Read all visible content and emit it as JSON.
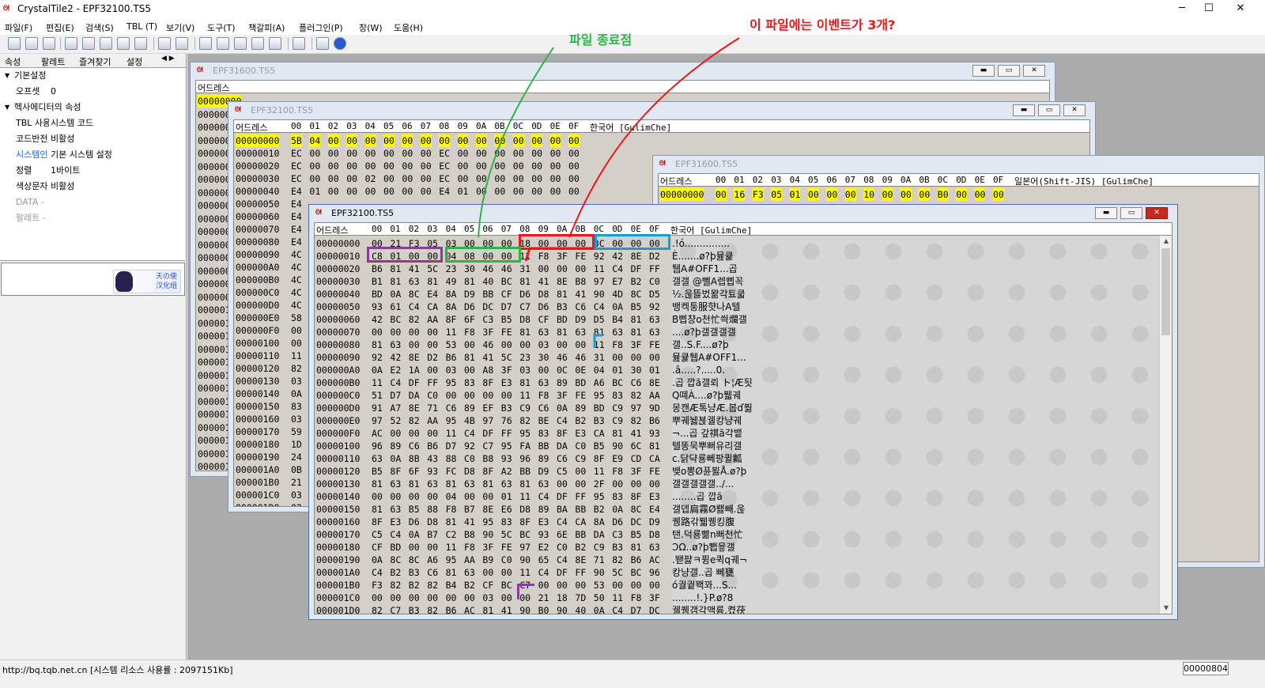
{
  "app": {
    "title": "CrystalTile2 - EPF32100.TS5",
    "min": "─",
    "max": "☐",
    "close": "✕"
  },
  "menu": [
    "파일(F)",
    "편집(E)",
    "검색(S)",
    "TBL (T)",
    "보기(V)",
    "도구(T)",
    "책갈피(A)",
    "플러그인(P)",
    "창(W)",
    "도움(H)"
  ],
  "panel": {
    "tabs": [
      "속성",
      "팔레트",
      "즐겨찾기",
      "설정"
    ],
    "tab_arrows": "◀ ▶",
    "rows": [
      {
        "key": "기본설정",
        "val": "",
        "type": "cat"
      },
      {
        "key": "오프셋",
        "val": "0",
        "type": "row"
      },
      {
        "key": "헥사에디터의 속성",
        "val": "",
        "type": "cat"
      },
      {
        "key": "TBL 사용",
        "val": "시스템 코드",
        "type": "row"
      },
      {
        "key": "코드반전",
        "val": "비활성",
        "type": "row"
      },
      {
        "key": "시스템인",
        "val": "기본 시스템 설정",
        "type": "blue"
      },
      {
        "key": "정렬",
        "val": "1바이트",
        "type": "row"
      },
      {
        "key": "색상문자",
        "val": "비활성",
        "type": "row"
      },
      {
        "key": "DATA -",
        "val": "",
        "type": "gray"
      },
      {
        "key": "팔레트 -",
        "val": "",
        "type": "gray"
      }
    ],
    "logo_text": "天の使\n汉化组"
  },
  "annotations": {
    "events_question": "이 파일에는 이벤트가 3개?",
    "file_end": "파일 종료점"
  },
  "hex_header": {
    "addr_label": "어드레스",
    "cols": [
      "00",
      "01",
      "02",
      "03",
      "04",
      "05",
      "06",
      "07",
      "08",
      "09",
      "0A",
      "0B",
      "0C",
      "0D",
      "0E",
      "0F"
    ],
    "charset_label": "한국어 [GulimChe]",
    "charset_label_jp": "일본어(Shift-JIS) [GulimChe]"
  },
  "windows": {
    "w1": {
      "title": "EPF31600.TS5",
      "addresses": [
        "00000000",
        "00000010",
        "00000020",
        "00000030",
        "00000040",
        "00000050",
        "00000060",
        "00000070",
        "00000080",
        "00000090",
        "000000A0",
        "000000B0",
        "000000C0",
        "000000D0",
        "000000E0",
        "000000F0",
        "00000100",
        "00000110",
        "00000120",
        "00000130",
        "00000140",
        "00000150",
        "00000160",
        "00000170",
        "00000180",
        "00000190",
        "000001A0",
        "000001B0",
        "000001C0",
        "000001D0"
      ]
    },
    "w2": {
      "title": "EPF32100.TS5",
      "rows": [
        {
          "a": "00000000",
          "h": "5B 04 00 00 00 00 00 00 00 00 00 00 00 00 00 00"
        },
        {
          "a": "00000010",
          "h": "EC 00 00 00 00 00 00 00 EC 00 00 00 00 00 00 00"
        },
        {
          "a": "00000020",
          "h": "EC 00 00 00 00 00 00 00 EC 00 00 00 00 00 00 00"
        },
        {
          "a": "00000030",
          "h": "EC 00 00 00 02 00 00 00 EC 00 00 00 00 00 00 00"
        },
        {
          "a": "00000040",
          "h": "E4 01 00 00 00 00 00 00 E4 01 00 00 00 00 00 00"
        },
        {
          "a": "00000050",
          "h": "E4"
        },
        {
          "a": "00000060",
          "h": "E4"
        },
        {
          "a": "00000070",
          "h": "E4"
        },
        {
          "a": "00000080",
          "h": "E4"
        },
        {
          "a": "00000090",
          "h": "4C"
        },
        {
          "a": "000000A0",
          "h": "4C"
        },
        {
          "a": "000000B0",
          "h": "4C"
        },
        {
          "a": "000000C0",
          "h": "4C"
        },
        {
          "a": "000000D0",
          "h": "4C"
        },
        {
          "a": "000000E0",
          "h": "58"
        },
        {
          "a": "000000F0",
          "h": "00"
        },
        {
          "a": "00000100",
          "h": "00"
        },
        {
          "a": "00000110",
          "h": "11"
        },
        {
          "a": "00000120",
          "h": "82"
        },
        {
          "a": "00000130",
          "h": "03"
        },
        {
          "a": "00000140",
          "h": "0A"
        },
        {
          "a": "00000150",
          "h": "83"
        },
        {
          "a": "00000160",
          "h": "03"
        },
        {
          "a": "00000170",
          "h": "59"
        },
        {
          "a": "00000180",
          "h": "1D"
        },
        {
          "a": "00000190",
          "h": "24"
        },
        {
          "a": "000001A0",
          "h": "0B"
        },
        {
          "a": "000001B0",
          "h": "21"
        },
        {
          "a": "000001C0",
          "h": "03"
        },
        {
          "a": "000001D0",
          "h": "02"
        }
      ]
    },
    "w3": {
      "title": "EPF31600.TS5",
      "rows": [
        {
          "a": "00000000",
          "h": "00 16 F3 05 01 00 00 00 10 00 00 00 B0 00 00 00"
        }
      ]
    },
    "w4": {
      "title": "EPF32100.TS5",
      "rows": [
        {
          "a": "00000000",
          "h": "00 21 F3 05 03 00 00 00 18 00 00 00 8C 00 00 00",
          "c": ".!ó..............."
        },
        {
          "a": "00000010",
          "h": "C8 01 00 00 04 08 00 00 11 F8 3F FE 92 42 8E D2",
          "c": "È.......ø?þ뮲큝"
        },
        {
          "a": "00000020",
          "h": "B6 81 41 5C 23 30 46 46 31 00 00 00 11 C4 DF FF",
          "c": "퉵A#OFF1...곱"
        },
        {
          "a": "00000030",
          "h": "B1 81 63 81 49 81 40 BC 81 41 8E B8 97 E7 B2 C0",
          "c": "갤갤 @뻴A렙삡꼭"
        },
        {
          "a": "00000040",
          "h": "BD 0A 8C E4 8A D9 BB CF D6 D8 81 41 90 4D 8C D5",
          "c": "½.욶뜷벘뫎각툐쿫"
        },
        {
          "a": "00000050",
          "h": "93 61 C4 CA 8A D6 DC D7 C7 D6 B3 C6 C4 0A B5 92",
          "c": "뱅켁퉁服햣나A텔"
        },
        {
          "a": "00000060",
          "h": "42 BC 82 AA 8F 6F C3 B5 D8 CF BD D9 D5 B4 81 63",
          "c": "B삡챵o천忙씍爛갤"
        },
        {
          "a": "00000070",
          "h": "00 00 00 00 11 F8 3F FE 81 63 81 63 81 63 81 63",
          "c": "....ø?þ갤갤갤갤"
        },
        {
          "a": "00000080",
          "h": "81 63 00 00 53 00 46 00 00 03 00 00 11 F8 3F FE",
          "c": "갤..S.F....ø?þ"
        },
        {
          "a": "00000090",
          "h": "92 42 8E D2 B6 81 41 5C 23 30 46 46 31 00 00 00",
          "c": "뮲큝퉵A#OFF1..."
        },
        {
          "a": "000000A0",
          "h": "0A E2 1A 00 03 00 A8 3F 03 00 0C 0E 04 01 30 01",
          "c": ".â.....?.....0."
        },
        {
          "a": "000000B0",
          "h": "11 C4 DF FF 95 83 8F E3 81 63 89 BD A6 BC C6 8E",
          "c": ".곱 깝ã갤뢰 ト¦Æ됫"
        },
        {
          "a": "000000C0",
          "h": "51 D7 DA C0 00 00 00 00 11 F8 3F FE 95 83 82 AA",
          "c": "Q뗴À....ø?þ뷃궤"
        },
        {
          "a": "000000D0",
          "h": "91 A7 8E 71 C6 89 EF B3 C9 C6 0A 89 BD C9 97 9D",
          "c": "몽캔Æ톡냥Æ.봅ɗ붦"
        },
        {
          "a": "000000E0",
          "h": "97 52 82 AA 95 4B 97 76 82 BE C4 B2 B3 C9 82 B6",
          "c": "뿌궤뉋뵩궬캉냥궤"
        },
        {
          "a": "000000F0",
          "h": "AC 00 00 00 11 C4 DF FF 95 83 8F E3 CA 81 41 93",
          "c": "¬...곱 갚祺ã각뱉"
        },
        {
          "a": "00000100",
          "h": "96 89 C6 B6 D7 92 C7 95 FA BB DA C0 B5 90 6C 81",
          "c": " 텔똥묵뿌뻐유리갤"
        },
        {
          "a": "00000110",
          "h": "63 0A 8B 43 88 C0 B8 93 96 89 C6 C9 8F E9 CD CA",
          "c": "c.닭댝룡뻬팡퀼瓤"
        },
        {
          "a": "00000120",
          "h": "B5 8F 6F 93 FC D8 8F A2 BB D9 C5 00 11 F8 3F FE",
          "c": "뱆o뽕Ø퓬뵗Å.ø?þ"
        },
        {
          "a": "00000130",
          "h": "81 63 81 63 81 63 81 63 81 63 00 00 2F 00 00 00",
          "c": "갤갤갤갤갤../..."
        },
        {
          "a": "00000140",
          "h": "00 00 00 00 04 00 00 01 11 C4 DF FF 95 83 8F E3",
          "c": "........곱 깝ã"
        },
        {
          "a": "00000150",
          "h": "81 63 B5 88 F8 B7 8E E6 D8 89 BA BB B2 0A 8C E4",
          "c": "갤뎁扁霧Ø뢣빼.욶"
        },
        {
          "a": "00000160",
          "h": "8F E3 D6 D8 81 41 95 83 8F E3 C4 CA 8A D6 DC D9",
          "c": "퀭路갂뷃퀭킹腹"
        },
        {
          "a": "00000170",
          "h": "C5 C4 0A B7 C2 B8 90 5C BC 93 6E BB DA C3 B5 D8",
          "c": "탠.덕룡빪n뻐천忙"
        },
        {
          "a": "00000180",
          "h": "CF BD 00 00 11 F8 3F FE 97 E2 C0 B2 C9 B3 81 63",
          "c": "ϽΩ..ø?þ뾉윻갤"
        },
        {
          "a": "00000190",
          "h": "0A 8C 8C A6 95 AA B9 C0 90 65 C4 8E 71 82 B6 AC",
          "c": ".뙏퍓ㅋ퓡e퀵q궤¬"
        },
        {
          "a": "000001A0",
          "h": "C4 B2 B3 C6 81 63 00 00 11 C4 DF FF 90 5C BC 96",
          "c": "캉냥갤..곱 뻬甕"
        },
        {
          "a": "000001B0",
          "h": "F3 82 B2 82 B4 B2 CF BC C7 00 00 00 53 00 00 00",
          "c": "ó궐궡뫡꽈...S..."
        },
        {
          "a": "000001C0",
          "h": "00 00 00 00 00 00 03 00 00 21 18 7D 50 11 F8 3F",
          "c": "........!.}P.ø?8"
        },
        {
          "a": "000001D0",
          "h": "82 C7 B3 82 B6 AC 81 41 90 B0 90 40 0A C4 D7 DC",
          "c": "궬퀭갬각맥륨.켰茯"
        }
      ]
    }
  },
  "status": {
    "text": "http://bq.tqb.net.cn [시스템 리소스 사용률 : 2097151Kb]",
    "offset": "00000804"
  },
  "colors": {
    "red": "#e8191d",
    "green": "#2fb24a",
    "blue": "#1b9ad6",
    "purple": "#8a3c9e",
    "highlight_blue": "#7b7bff",
    "highlight_yellow": "#ffff00"
  }
}
